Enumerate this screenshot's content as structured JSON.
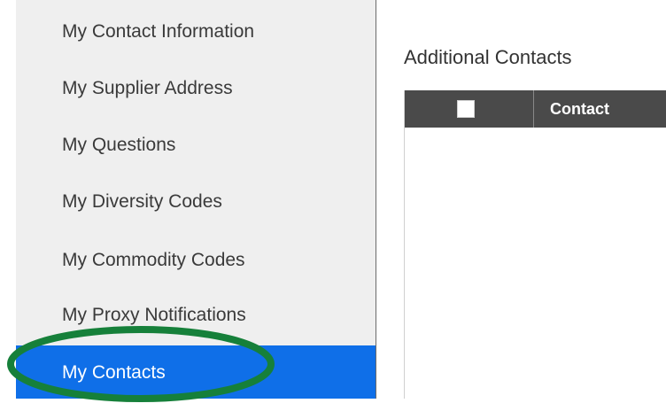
{
  "sidebar": {
    "items": [
      {
        "label": "My Contact Information"
      },
      {
        "label": "My Supplier Address"
      },
      {
        "label": "My Questions"
      },
      {
        "label": "My Diversity Codes"
      },
      {
        "label": "My Commodity Codes"
      },
      {
        "label": "My Proxy Notifications"
      },
      {
        "label": "My Contacts",
        "active": true
      }
    ],
    "background_color": "#efefef",
    "active_color": "#0f6fe8"
  },
  "annotation": {
    "highlight_color": "#16803a",
    "shape": "ellipse"
  },
  "main": {
    "title": "Additional Contacts",
    "table": {
      "columns": [
        "Contact"
      ],
      "header_color": "#4a4a4a",
      "select_all_checked": false,
      "rows": []
    }
  }
}
